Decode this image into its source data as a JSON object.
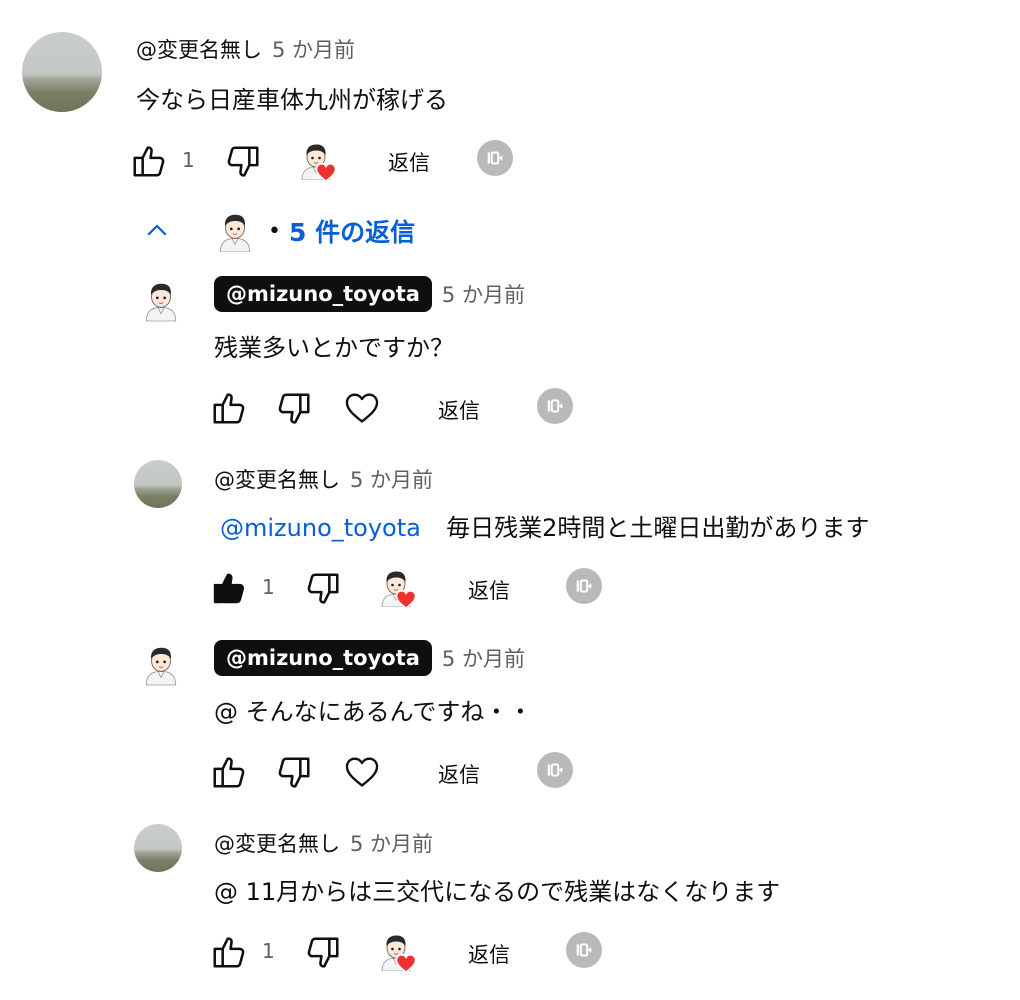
{
  "comment": {
    "author": "@変更名無し",
    "time": "5 か月前",
    "text": "今なら日産車体九州が稼げる",
    "like_count": "1",
    "reply_label": "返信"
  },
  "replies_toggle": {
    "label": "5 件の返信",
    "dot": "•"
  },
  "replies": [
    {
      "author": "@mizuno_toyota",
      "time": "5 か月前",
      "text": "残業多いとかですか？",
      "reply_label": "返信"
    },
    {
      "author": "@変更名無し",
      "time": "5 か月前",
      "mention": "@mizuno_toyota",
      "text": "毎日残業2時間と土曜日出勤があります",
      "like_count": "1",
      "reply_label": "返信"
    },
    {
      "author": "@mizuno_toyota",
      "time": "5 か月前",
      "text": "@ そんなにあるんですね・・",
      "reply_label": "返信"
    },
    {
      "author": "@変更名無し",
      "time": "5 か月前",
      "text": "@ 11月からは三交代になるので残業はなくなります",
      "like_count": "1",
      "reply_label": "返信"
    }
  ]
}
